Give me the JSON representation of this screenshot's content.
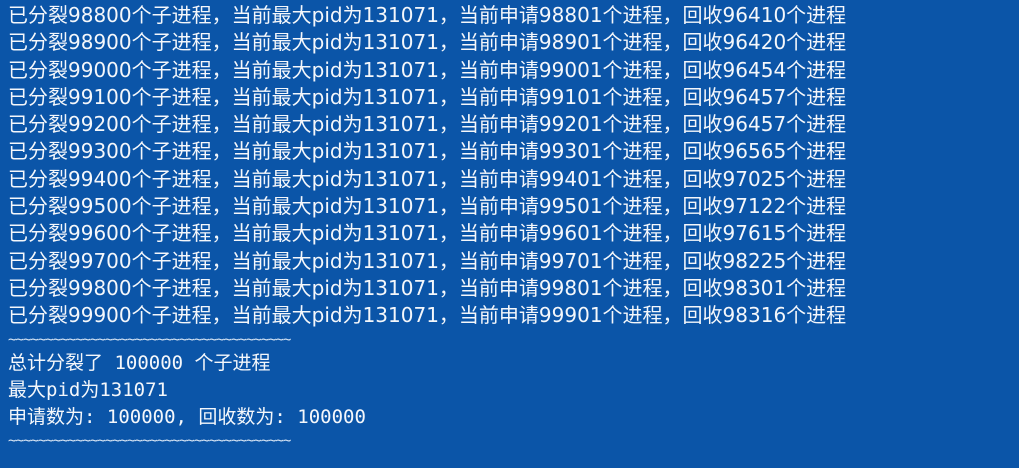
{
  "console": {
    "background_color": "#0b55a8",
    "text_color": "#f4f7fb",
    "log_lines": [
      "已分裂98800个子进程，当前最大pid为131071，当前申请98801个进程，回收96410个进程",
      "已分裂98900个子进程，当前最大pid为131071，当前申请98901个进程，回收96420个进程",
      "已分裂99000个子进程，当前最大pid为131071，当前申请99001个进程，回收96454个进程",
      "已分裂99100个子进程，当前最大pid为131071，当前申请99101个进程，回收96457个进程",
      "已分裂99200个子进程，当前最大pid为131071，当前申请99201个进程，回收96457个进程",
      "已分裂99300个子进程，当前最大pid为131071，当前申请99301个进程，回收96565个进程",
      "已分裂99400个子进程，当前最大pid为131071，当前申请99401个进程，回收97025个进程",
      "已分裂99500个子进程，当前最大pid为131071，当前申请99501个进程，回收97122个进程",
      "已分裂99600个子进程，当前最大pid为131071，当前申请99601个进程，回收97615个进程",
      "已分裂99700个子进程，当前最大pid为131071，当前申请99701个进程，回收98225个进程",
      "已分裂99800个子进程，当前最大pid为131071，当前申请99801个进程，回收98301个进程",
      "已分裂99900个子进程，当前最大pid为131071，当前申请99901个进程，回收98316个进程"
    ],
    "separator_top": "~~~~~~~~~~~~~~~~~~~~~~~~~~~~~~~~~~~~~~",
    "summary": {
      "total_line": "总计分裂了 100000 个子进程",
      "max_pid_line": "最大pid为131071",
      "counts_line": "申请数为: 100000, 回收数为: 100000"
    },
    "separator_bottom": "~~~~~~~~~~~~~~~~~~~~~~~~~~~~~~~~~~~~~~"
  }
}
